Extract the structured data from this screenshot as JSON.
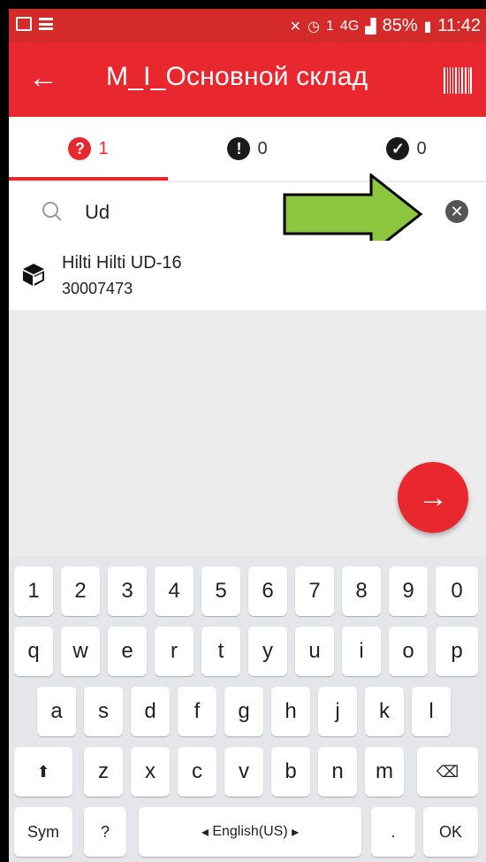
{
  "status_bar": {
    "battery": "85%",
    "time": "11:42",
    "network": "4G",
    "sim": "1"
  },
  "app_bar": {
    "title": "M_I_Основной склад"
  },
  "tabs": [
    {
      "icon": "question-icon",
      "count": "1"
    },
    {
      "icon": "exclamation-icon",
      "count": "0"
    },
    {
      "icon": "check-icon",
      "count": "0"
    }
  ],
  "search": {
    "value": "Ud"
  },
  "items": [
    {
      "name": "Hilti Hilti UD-16",
      "code": "30007473"
    }
  ],
  "keyboard": {
    "row1": [
      "1",
      "2",
      "3",
      "4",
      "5",
      "6",
      "7",
      "8",
      "9",
      "0"
    ],
    "row2": [
      "q",
      "w",
      "e",
      "r",
      "t",
      "y",
      "u",
      "i",
      "o",
      "p"
    ],
    "row3": [
      "a",
      "s",
      "d",
      "f",
      "g",
      "h",
      "j",
      "k",
      "l"
    ],
    "row4": [
      "z",
      "x",
      "c",
      "v",
      "b",
      "n",
      "m"
    ],
    "sym": "Sym",
    "question": "?",
    "language": "English(US)",
    "period": ".",
    "ok": "OK"
  },
  "colors": {
    "accent": "#e8272e",
    "annotation_arrow": "#8cc63f"
  }
}
